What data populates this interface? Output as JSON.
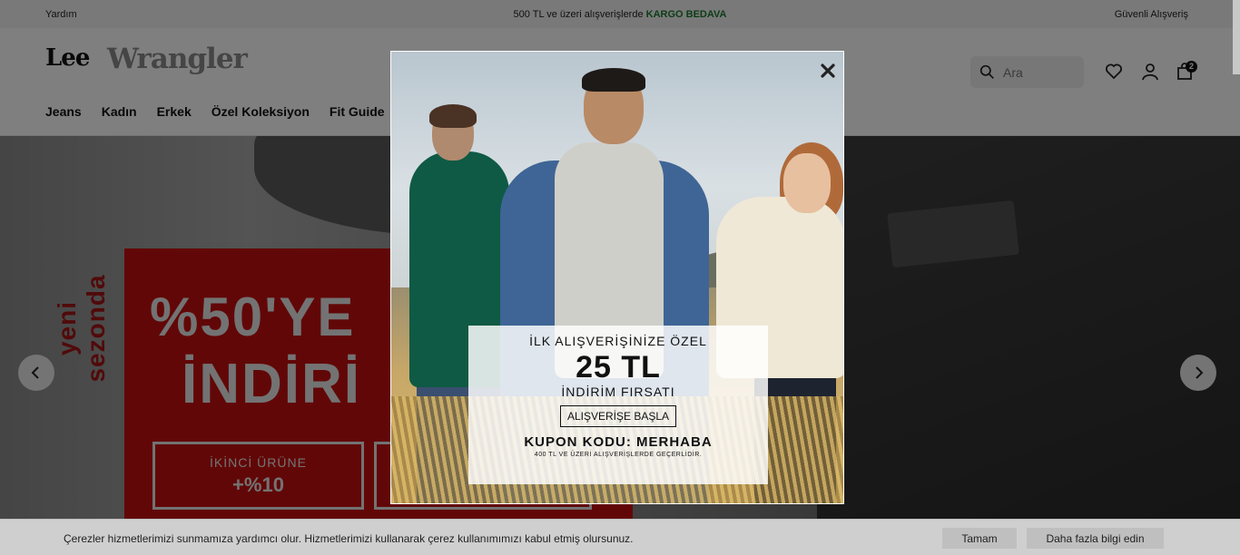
{
  "topbar": {
    "help": "Yardım",
    "promo_prefix": "500 TL ve üzeri alışverişlerde",
    "promo_accent": "KARGO BEDAVA",
    "secure": "Güvenli Alışveriş"
  },
  "header": {
    "brand_primary": "Lee",
    "brand_secondary": "Wrangler",
    "nav": [
      "Jeans",
      "Kadın",
      "Erkek",
      "Özel Koleksiyon",
      "Fit Guide"
    ],
    "search_placeholder": "Ara",
    "cart_count": "2",
    "icons": [
      "search-icon",
      "heart-icon",
      "user-icon",
      "shopping-bag-icon"
    ]
  },
  "hero": {
    "side_text": "yeni sezonda",
    "headline_1": "%50'YE",
    "headline_2": "İNDİRİ",
    "box1_line1": "İKİNCİ ÜRÜNE",
    "box1_line2": "+%10"
  },
  "modal": {
    "line1": "İLK ALIŞVERİŞİNİZE ÖZEL",
    "amount": "25 TL",
    "line3": "İNDİRİM FIRSATI",
    "cta": "ALIŞVERİŞE BAŞLA",
    "coupon": "KUPON KODU: MERHABA",
    "fineprint": "400 TL VE ÜZERİ ALIŞVERİŞLERDE GEÇERLİDİR."
  },
  "cookie": {
    "message": "Çerezler hizmetlerimizi sunmamıza yardımcı olur. Hizmetlerimizi kullanarak çerez kullanımımızı kabul etmiş olursunuz.",
    "accept": "Tamam",
    "more": "Daha fazla bilgi edin"
  },
  "colors": {
    "accent_green": "#1a7a2e",
    "hero_red": "#c40f0f"
  }
}
